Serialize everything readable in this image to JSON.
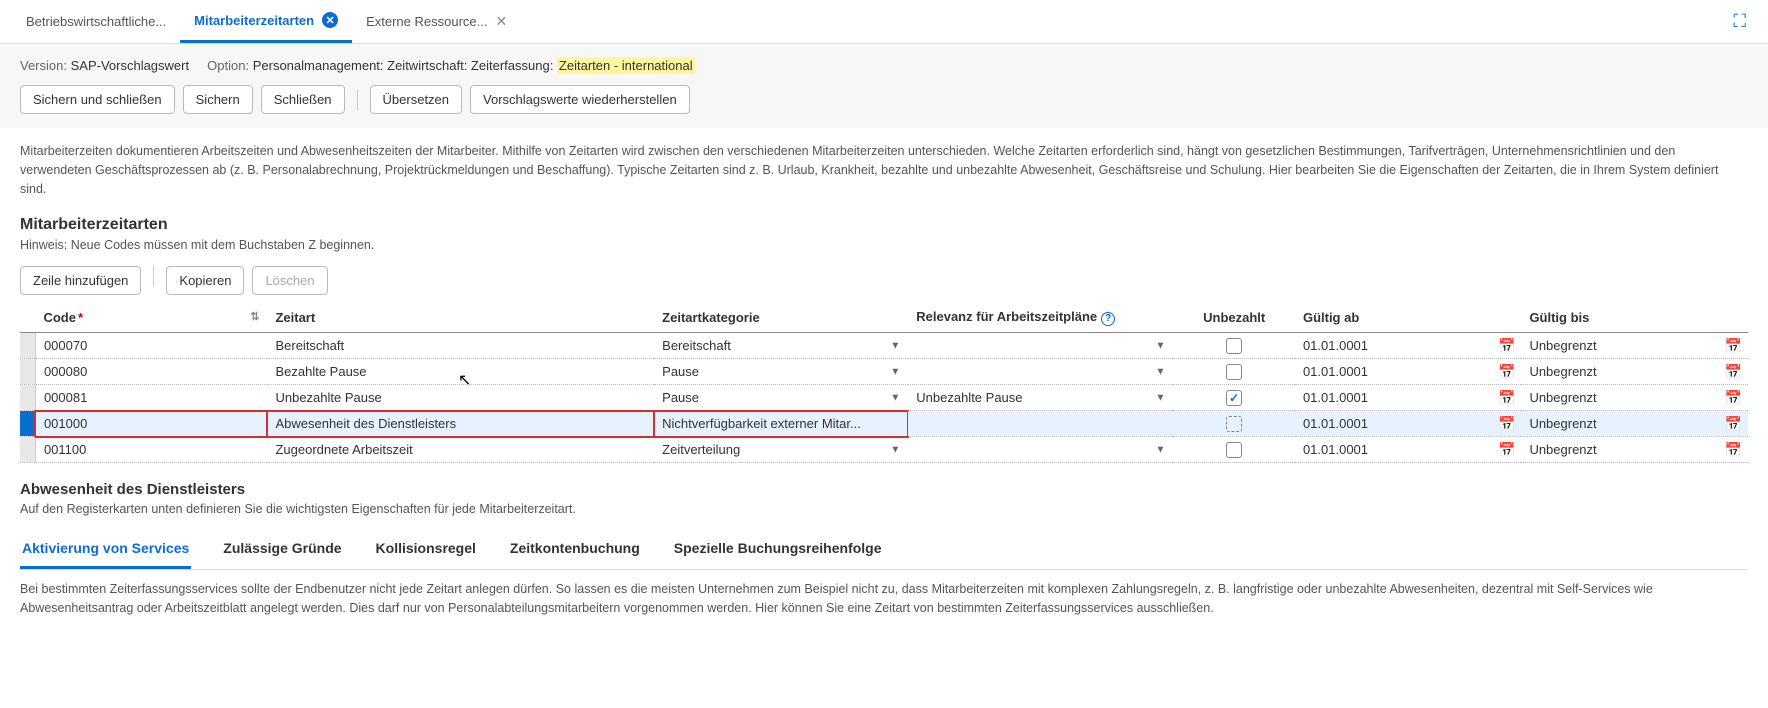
{
  "tabs": [
    {
      "label": "Betriebswirtschaftliche...",
      "active": false,
      "close": false
    },
    {
      "label": "Mitarbeiterzeitarten",
      "active": true,
      "close": true
    },
    {
      "label": "Externe Ressource...",
      "active": false,
      "close": true
    }
  ],
  "meta": {
    "version_label": "Version:",
    "version_value": "SAP-Vorschlagswert",
    "option_label": "Option:",
    "option_value_prefix": "Personalmanagement: Zeitwirtschaft: Zeiterfassung: ",
    "option_value_hl": "Zeitarten - international"
  },
  "toolbar": {
    "save_close": "Sichern und schließen",
    "save": "Sichern",
    "close": "Schließen",
    "translate": "Übersetzen",
    "restore": "Vorschlagswerte wiederherstellen"
  },
  "description": "Mitarbeiterzeiten dokumentieren Arbeitszeiten und Abwesenheitszeiten der Mitarbeiter. Mithilfe von Zeitarten wird zwischen den verschiedenen Mitarbeiterzeiten unterschieden. Welche Zeitarten erforderlich sind, hängt von gesetzlichen Bestimmungen, Tarifverträgen, Unternehmensrichtlinien und den verwendeten Geschäftsprozessen ab (z. B. Personalabrechnung, Projektrückmeldungen und Beschaffung). Typische Zeitarten sind z. B. Urlaub, Krankheit, bezahlte und unbezahlte Abwesenheit, Geschäftsreise und Schulung. Hier bearbeiten Sie die Eigenschaften der Zeitarten, die in Ihrem System definiert sind.",
  "section": {
    "title": "Mitarbeiterzeitarten",
    "hint": "Hinweis: Neue Codes müssen mit dem Buchstaben Z beginnen."
  },
  "row_toolbar": {
    "add": "Zeile hinzufügen",
    "copy": "Kopieren",
    "delete": "Löschen"
  },
  "columns": {
    "code": "Code",
    "zeitart": "Zeitart",
    "kategorie": "Zeitartkategorie",
    "relevanz": "Relevanz für Arbeitszeitpläne",
    "unbezahlt": "Unbezahlt",
    "von": "Gültig ab",
    "bis": "Gültig bis"
  },
  "rows": [
    {
      "code": "000070",
      "zeitart": "Bereitschaft",
      "kat": "Bereitschaft",
      "rel": "",
      "unb": false,
      "von": "01.01.0001",
      "bis": "Unbegrenzt",
      "selected": false,
      "highlight": false
    },
    {
      "code": "000080",
      "zeitart": "Bezahlte Pause",
      "kat": "Pause",
      "rel": "",
      "unb": false,
      "von": "01.01.0001",
      "bis": "Unbegrenzt",
      "selected": false,
      "highlight": false
    },
    {
      "code": "000081",
      "zeitart": "Unbezahlte Pause",
      "kat": "Pause",
      "rel": "Unbezahlte Pause",
      "unb": true,
      "von": "01.01.0001",
      "bis": "Unbegrenzt",
      "selected": false,
      "highlight": false
    },
    {
      "code": "001000",
      "zeitart": "Abwesenheit des Dienstleisters",
      "kat": "Nichtverfügbarkeit externer Mitar...",
      "rel": "",
      "unb": "inter",
      "von": "01.01.0001",
      "bis": "Unbegrenzt",
      "selected": true,
      "highlight": true
    },
    {
      "code": "001100",
      "zeitart": "Zugeordnete Arbeitszeit",
      "kat": "Zeitverteilung",
      "rel": "",
      "unb": false,
      "von": "01.01.0001",
      "bis": "Unbegrenzt",
      "selected": false,
      "highlight": false
    }
  ],
  "sub": {
    "title": "Abwesenheit des Dienstleisters",
    "hint": "Auf den Registerkarten unten definieren Sie die wichtigsten Eigenschaften für jede Mitarbeiterzeitart."
  },
  "subtabs": [
    {
      "label": "Aktivierung von Services",
      "active": true
    },
    {
      "label": "Zulässige Gründe",
      "active": false
    },
    {
      "label": "Kollisionsregel",
      "active": false
    },
    {
      "label": "Zeitkontenbuchung",
      "active": false
    },
    {
      "label": "Spezielle Buchungsreihenfolge",
      "active": false
    }
  ],
  "subdesc": "Bei bestimmten Zeiterfassungsservices sollte der Endbenutzer nicht jede Zeitart anlegen dürfen. So lassen es die meisten Unternehmen zum Beispiel nicht zu, dass Mitarbeiterzeiten mit komplexen Zahlungsregeln, z. B. langfristige oder unbezahlte Abwesenheiten, dezentral mit Self-Services wie Abwesenheitsantrag oder Arbeitszeitblatt angelegt werden. Dies darf nur von Personalabteilungsmitarbeitern vorgenommen werden. Hier können Sie eine Zeitart von bestimmten Zeiterfassungsservices ausschließen."
}
